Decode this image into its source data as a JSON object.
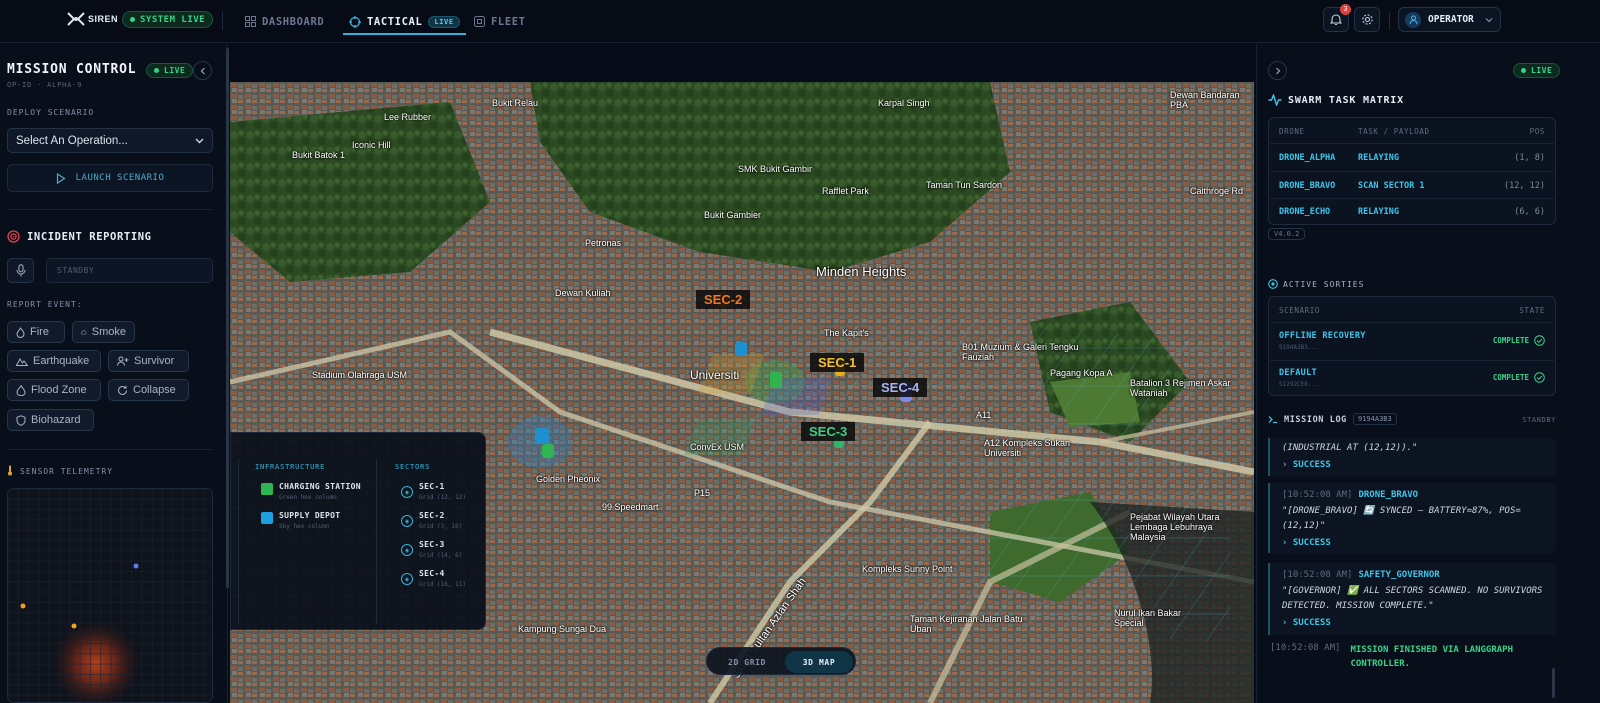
{
  "topbar": {
    "logo_text": "SIREN",
    "system_status": "SYSTEM LIVE",
    "nav": [
      {
        "label": "DASHBOARD",
        "icon": "grid-icon"
      },
      {
        "label": "TACTICAL",
        "icon": "crosshair-icon",
        "badge": "LIVE"
      },
      {
        "label": "FLEET",
        "icon": "box-icon"
      }
    ],
    "notification_count": "3",
    "user": "OPERATOR"
  },
  "left": {
    "title": "MISSION CONTROL",
    "live": "LIVE",
    "op_id": "OP-ID · ALPHA-9",
    "deploy_label": "DEPLOY SCENARIO",
    "select_value": "Select An Operation...",
    "launch_label": "LAUNCH SCENARIO",
    "incident_title": "INCIDENT REPORTING",
    "standby": "STANDBY",
    "report_label": "REPORT EVENT:",
    "events": [
      "Fire",
      "Smoke",
      "Earthquake",
      "Survivor",
      "Flood Zone",
      "Collapse",
      "Biohazard"
    ],
    "telemetry_title": "SENSOR TELEMETRY"
  },
  "map": {
    "sectors": [
      "SEC-1",
      "SEC-2",
      "SEC-3",
      "SEC-4"
    ],
    "place_labels": [
      "Bukit Relau",
      "Lee Rubber",
      "Iconic Hill",
      "Bukit Batok 1",
      "Karpal Singh",
      "SMK Bukit Gambir",
      "Rafflet Park",
      "Taman Tun Sardon",
      "Bukit Gambier",
      "Petronas",
      "Minden Heights",
      "Dewan Kuliah",
      "The Kapit's",
      "Stadium Olahraga USM",
      "B01 Muzium & Galeri Tengku Fauziah",
      "Universiti",
      "Pagang Kopa A",
      "ConvEx USM",
      "A11",
      "A12 Kompleks Sukan Universiti",
      "Golden Pheonix",
      "P15",
      "99 Speedmart",
      "Kompleks Sunny Point",
      "Taman Kejiranan Jalan Batu Uban",
      "Kampung Sungai Dua",
      "Jalan Sultan Azlan Shah",
      "Nurul Ikan Bakar Special",
      "Pejabat Wilayah Utara Lembaga Lebuhraya Malaysia",
      "Batalion 3 Rejimen Askar Wataniah",
      "Caithroge Rd",
      "Dewan Bandaran PBA"
    ],
    "legend": {
      "infra_title": "INFRASTRUCTURE",
      "sectors_title": "SECTORS",
      "infra": [
        {
          "name": "CHARGING STATION",
          "sub": "Green hex column",
          "color": "#2fb54f"
        },
        {
          "name": "SUPPLY DEPOT",
          "sub": "Sky hex column",
          "color": "#1ea0e0"
        }
      ],
      "sectors": [
        {
          "name": "SEC-1",
          "sub": "Grid (12, 12)"
        },
        {
          "name": "SEC-2",
          "sub": "Grid (3, 16)"
        },
        {
          "name": "SEC-3",
          "sub": "Grid (14, 6)"
        },
        {
          "name": "SEC-4",
          "sub": "Grid (16, 11)"
        }
      ]
    },
    "view_toggle": {
      "grid": "2D GRID",
      "map": "3D MAP",
      "active": "3D MAP"
    }
  },
  "right": {
    "live": "LIVE",
    "swarm_title": "SWARM TASK MATRIX",
    "columns": [
      "DRONE",
      "TASK / PAYLOAD",
      "POS"
    ],
    "rows": [
      {
        "drone": "DRONE_ALPHA",
        "task": "RELAYING",
        "pos": "(1, 8)"
      },
      {
        "drone": "DRONE_BRAVO",
        "task": "SCAN SECTOR 1",
        "pos": "(12, 12)"
      },
      {
        "drone": "DRONE_ECHO",
        "task": "RELAYING",
        "pos": "(6, 6)"
      }
    ],
    "version": "V4.0.2",
    "sorties_title": "ACTIVE SORTIES",
    "sortie_columns": [
      "SCENARIO",
      "STATE"
    ],
    "sorties": [
      {
        "name": "OFFLINE RECOVERY",
        "id": "9194A3B3...",
        "state": "COMPLETE"
      },
      {
        "name": "DEFAULT",
        "id": "51292CE8...",
        "state": "COMPLETE"
      }
    ],
    "log_title": "MISSION LOG",
    "log_id": "9194A3B3",
    "log_state": "STANDBY",
    "log": [
      {
        "msg": "(INDUSTRIAL AT (12,12)).\"",
        "ok": "› SUCCESS"
      },
      {
        "ts": "[10:52:08 AM]",
        "who": "DRONE_BRAVO",
        "msg": "\"[DRONE_BRAVO] 🔄 SYNCED — BATTERY=87%, POS=(12,12)\"",
        "ok": "› SUCCESS"
      },
      {
        "ts": "[10:52:08 AM]",
        "who": "SAFETY_GOVERNOR",
        "msg": "\"[GOVERNOR] ✅ ALL SECTORS SCANNED. NO SURVIVORS DETECTED. MISSION COMPLETE.\"",
        "ok": "› SUCCESS"
      }
    ],
    "final_ts": "[10:52:08 AM]",
    "final_msg": "MISSION FINISHED VIA LANGGRAPH CONTROLLER."
  },
  "colors": {
    "accent": "#3ec6ea",
    "success": "#36d48a",
    "bg": "#070d18"
  }
}
